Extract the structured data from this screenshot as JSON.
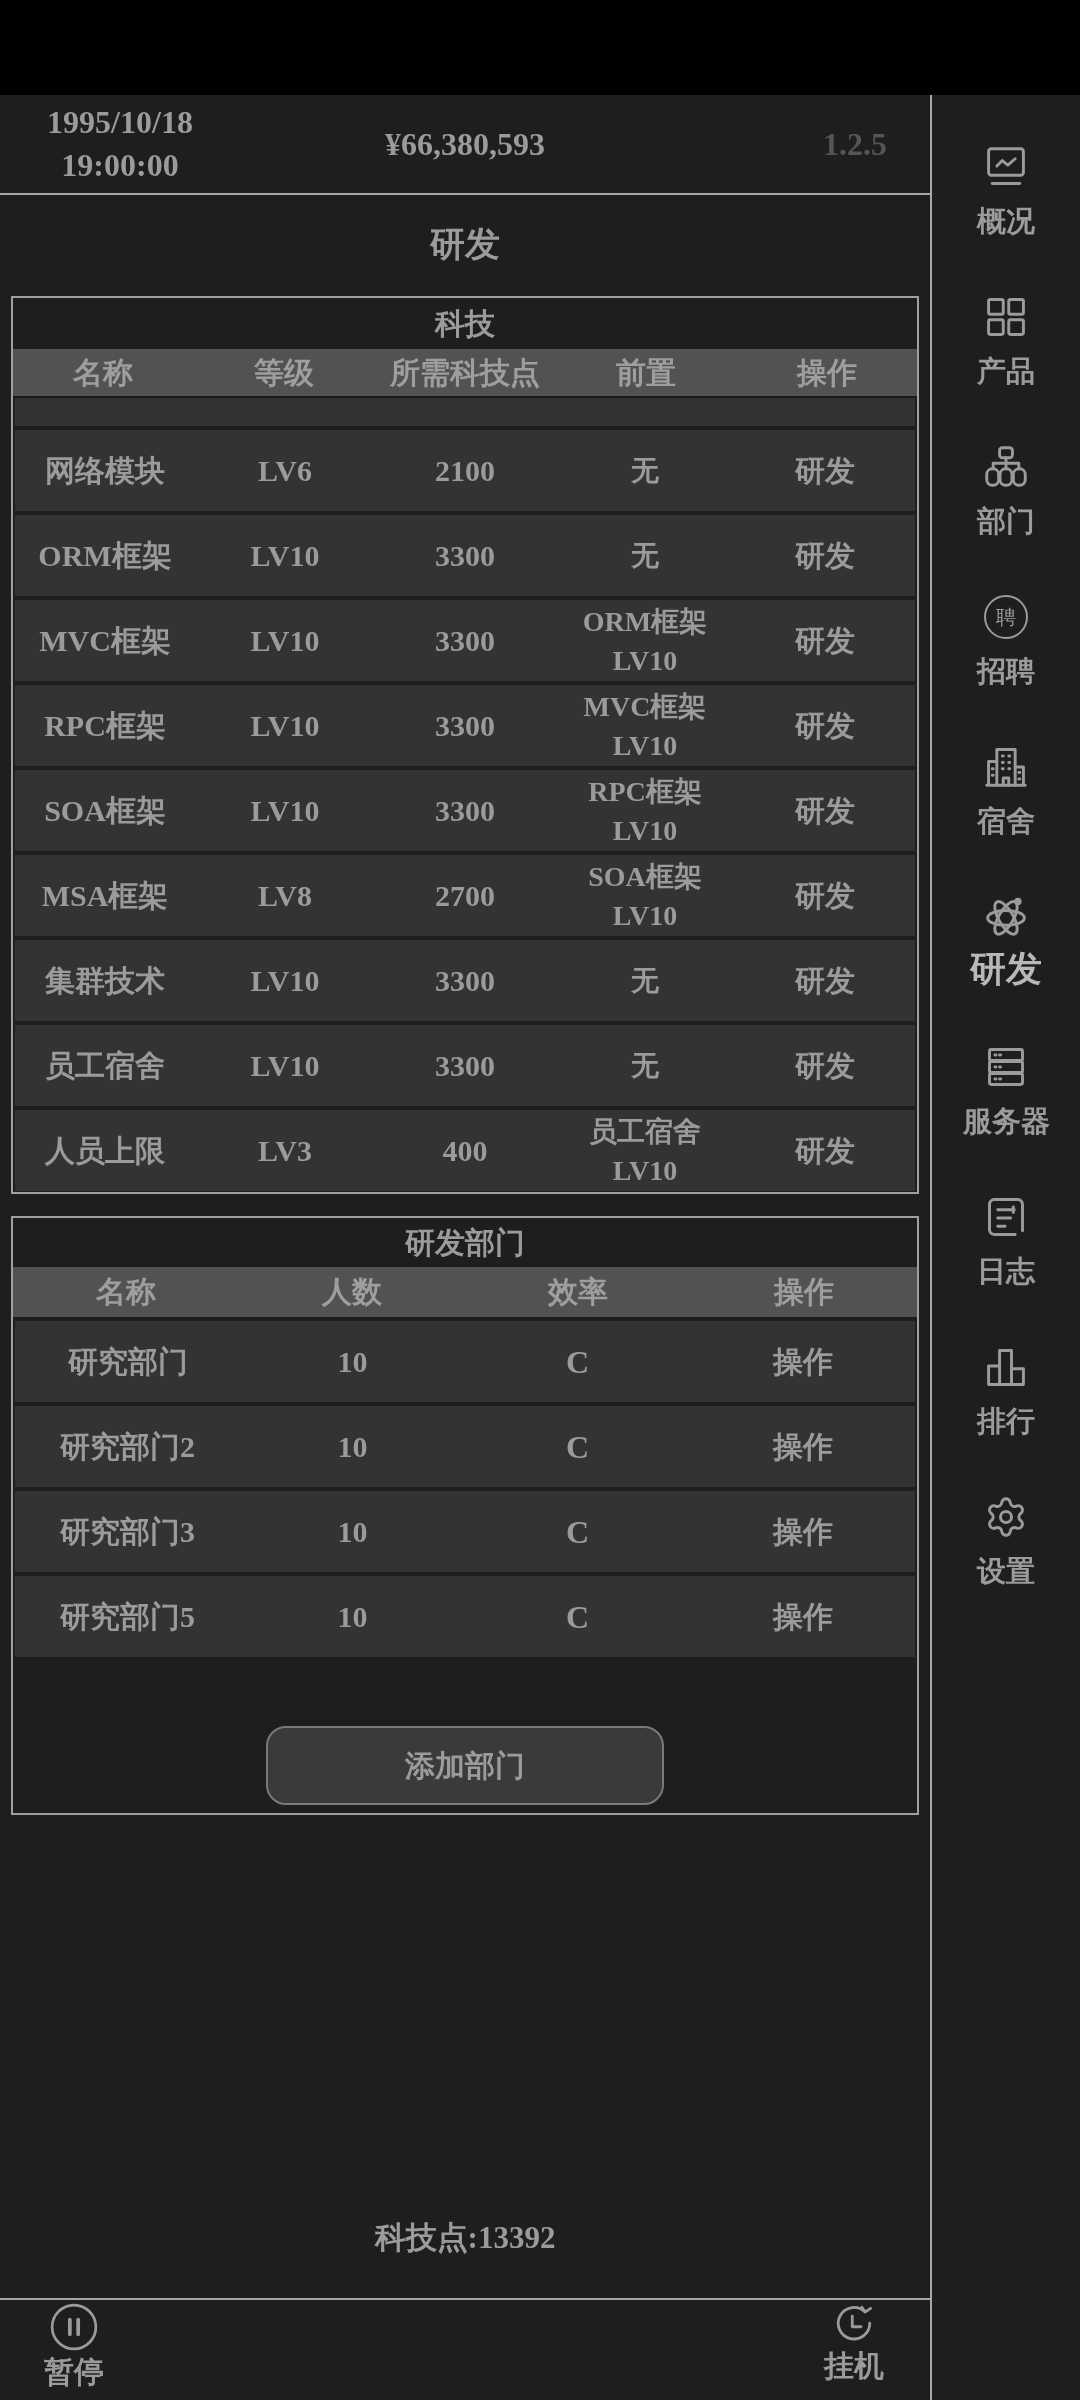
{
  "header": {
    "date": "1995/10/18",
    "time": "19:00:00",
    "money": "¥66,380,593",
    "version": "1.2.5"
  },
  "page_title": "研发",
  "tech_table": {
    "title": "科技",
    "columns": [
      "名称",
      "等级",
      "所需科技点",
      "前置",
      "操作"
    ],
    "rows": [
      {
        "name": "网络模块",
        "level": "LV6",
        "cost": "2100",
        "prerequisite": [
          "无"
        ],
        "action": "研发"
      },
      {
        "name": "ORM框架",
        "level": "LV10",
        "cost": "3300",
        "prerequisite": [
          "无"
        ],
        "action": "研发"
      },
      {
        "name": "MVC框架",
        "level": "LV10",
        "cost": "3300",
        "prerequisite": [
          "ORM框架",
          "LV10"
        ],
        "action": "研发"
      },
      {
        "name": "RPC框架",
        "level": "LV10",
        "cost": "3300",
        "prerequisite": [
          "MVC框架",
          "LV10"
        ],
        "action": "研发"
      },
      {
        "name": "SOA框架",
        "level": "LV10",
        "cost": "3300",
        "prerequisite": [
          "RPC框架",
          "LV10"
        ],
        "action": "研发"
      },
      {
        "name": "MSA框架",
        "level": "LV8",
        "cost": "2700",
        "prerequisite": [
          "SOA框架",
          "LV10"
        ],
        "action": "研发"
      },
      {
        "name": "集群技术",
        "level": "LV10",
        "cost": "3300",
        "prerequisite": [
          "无"
        ],
        "action": "研发"
      },
      {
        "name": "员工宿舍",
        "level": "LV10",
        "cost": "3300",
        "prerequisite": [
          "无"
        ],
        "action": "研发"
      },
      {
        "name": "人员上限",
        "level": "LV3",
        "cost": "400",
        "prerequisite": [
          "员工宿舍",
          "LV10"
        ],
        "action": "研发"
      }
    ]
  },
  "department_table": {
    "title": "研发部门",
    "columns": [
      "名称",
      "人数",
      "效率",
      "操作"
    ],
    "rows": [
      {
        "name": "研究部门",
        "staff": "10",
        "efficiency": "C",
        "action": "操作"
      },
      {
        "name": "研究部门2",
        "staff": "10",
        "efficiency": "C",
        "action": "操作"
      },
      {
        "name": "研究部门3",
        "staff": "10",
        "efficiency": "C",
        "action": "操作"
      },
      {
        "name": "研究部门5",
        "staff": "10",
        "efficiency": "C",
        "action": "操作"
      }
    ],
    "add_button": "添加部门"
  },
  "tech_points": "科技点:13392",
  "bottom_bar": [
    {
      "label": "暂停"
    },
    {
      "label": "挂机"
    }
  ],
  "sidebar": {
    "items": [
      {
        "label": "概况",
        "selected": false
      },
      {
        "label": "产品",
        "selected": false
      },
      {
        "label": "部门",
        "selected": false
      },
      {
        "label": "招聘",
        "glyph": "聘",
        "selected": false
      },
      {
        "label": "宿舍",
        "selected": false
      },
      {
        "label": "研发",
        "selected": true
      },
      {
        "label": "服务器",
        "selected": false
      },
      {
        "label": "日志",
        "selected": false
      },
      {
        "label": "排行",
        "selected": false
      },
      {
        "label": "设置",
        "selected": false
      }
    ]
  }
}
